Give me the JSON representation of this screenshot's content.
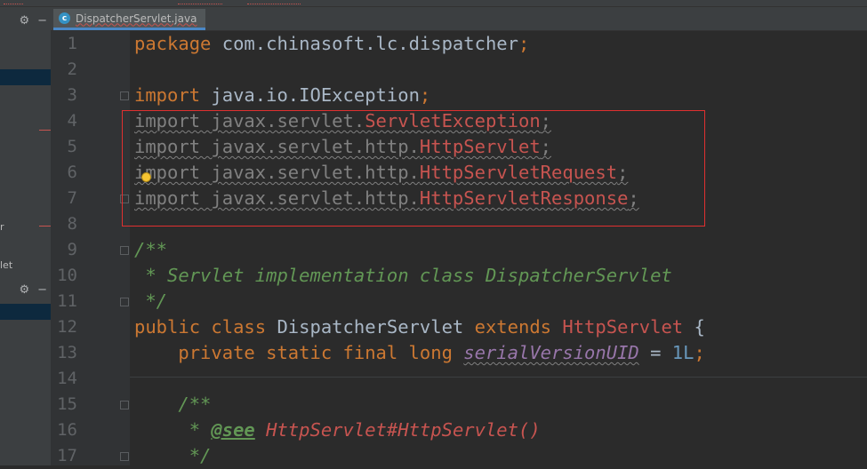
{
  "editor_tab": {
    "label": "DispatcherServlet.java",
    "icon": "java-class-icon"
  },
  "left_panel": {
    "text_r": "r",
    "text_let": "let",
    "tools_icons": [
      "gear-icon",
      "hide-icon"
    ]
  },
  "lines": [
    {
      "num": "1",
      "tokens": [
        {
          "t": "package ",
          "c": "kw"
        },
        {
          "t": "com.chinasoft.lc.dispatcher",
          "c": "pl"
        },
        {
          "t": ";",
          "c": "kw"
        }
      ]
    },
    {
      "num": "2",
      "tokens": []
    },
    {
      "num": "3",
      "tokens": [
        {
          "t": "import ",
          "c": "kw"
        },
        {
          "t": "java.io.IOException",
          "c": "pl"
        },
        {
          "t": ";",
          "c": "kw"
        }
      ]
    },
    {
      "num": "4",
      "tokens": [
        {
          "t": "import javax.servlet.",
          "c": "dim"
        },
        {
          "t": "ServletException",
          "c": "cls"
        },
        {
          "t": ";",
          "c": "dim"
        }
      ],
      "wavy": true
    },
    {
      "num": "5",
      "tokens": [
        {
          "t": "import javax.servlet.http.",
          "c": "dim"
        },
        {
          "t": "HttpServlet",
          "c": "cls"
        },
        {
          "t": ";",
          "c": "dim"
        }
      ],
      "wavy": true
    },
    {
      "num": "6",
      "tokens": [
        {
          "t": "import javax.servlet.http.",
          "c": "dim"
        },
        {
          "t": "HttpServletRequest",
          "c": "cls"
        },
        {
          "t": ";",
          "c": "dim"
        }
      ],
      "wavy": true
    },
    {
      "num": "7",
      "tokens": [
        {
          "t": "import javax.servlet.http.",
          "c": "dim"
        },
        {
          "t": "HttpServletResponse",
          "c": "cls"
        },
        {
          "t": ";",
          "c": "dim"
        }
      ],
      "wavy": true
    },
    {
      "num": "8",
      "tokens": []
    },
    {
      "num": "9",
      "tokens": [
        {
          "t": "/**",
          "c": "cm"
        }
      ]
    },
    {
      "num": "10",
      "tokens": [
        {
          "t": " * Servlet implementation class DispatcherServlet",
          "c": "cm"
        }
      ]
    },
    {
      "num": "11",
      "tokens": [
        {
          "t": " */",
          "c": "cm"
        }
      ]
    },
    {
      "num": "12",
      "tokens": [
        {
          "t": "public class ",
          "c": "kw"
        },
        {
          "t": "DispatcherServlet ",
          "c": "pl"
        },
        {
          "t": "extends ",
          "c": "kw"
        },
        {
          "t": "HttpServlet",
          "c": "cls"
        },
        {
          "t": " {",
          "c": "pl"
        }
      ]
    },
    {
      "num": "13",
      "tokens": [
        {
          "t": "    ",
          "c": "pl"
        },
        {
          "t": "private static final long ",
          "c": "kw"
        },
        {
          "t": "serialVersionUID",
          "c": "fld",
          "wavy": true
        },
        {
          "t": " = ",
          "c": "pl"
        },
        {
          "t": "1L",
          "c": "num"
        },
        {
          "t": ";",
          "c": "kw"
        }
      ]
    },
    {
      "num": "14",
      "tokens": []
    },
    {
      "num": "15",
      "tokens": [
        {
          "t": "    /**",
          "c": "cm"
        }
      ]
    },
    {
      "num": "16",
      "tokens": [
        {
          "t": "     * ",
          "c": "cm"
        },
        {
          "t": "@see",
          "c": "tag"
        },
        {
          "t": " ",
          "c": "cm"
        },
        {
          "t": "HttpServlet#HttpServlet()",
          "c": "ref"
        }
      ]
    },
    {
      "num": "17",
      "tokens": [
        {
          "t": "     */",
          "c": "cm"
        }
      ]
    }
  ]
}
